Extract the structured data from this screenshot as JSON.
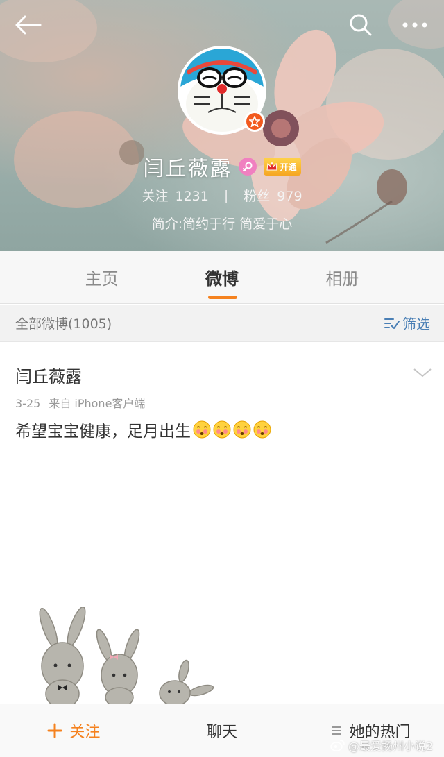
{
  "header": {
    "user_name": "闫丘薇露",
    "vip_label": "开通",
    "stats": {
      "following_label": "关注",
      "following_count": "1231",
      "separator": "|",
      "followers_label": "粉丝",
      "followers_count": "979"
    },
    "bio": "简介:简约于行 简爱于心"
  },
  "tabs": [
    {
      "label": "主页",
      "active": false
    },
    {
      "label": "微博",
      "active": true
    },
    {
      "label": "相册",
      "active": false
    }
  ],
  "filter_bar": {
    "all_label": "全部微博(1005)",
    "filter_label": "筛选"
  },
  "post": {
    "author": "闫丘薇露",
    "date": "3-25",
    "source": "来自 iPhone客户端",
    "text": "希望宝宝健康，足月出生",
    "emoji_count": 4
  },
  "bottom_bar": {
    "follow_label": "关注",
    "chat_label": "聊天",
    "hot_label": "她的热门"
  },
  "watermark": "@最爱扬州小说2",
  "colors": {
    "accent": "#f5821f",
    "link": "#4a7fb5",
    "vip_badge": "#f25a1f"
  }
}
